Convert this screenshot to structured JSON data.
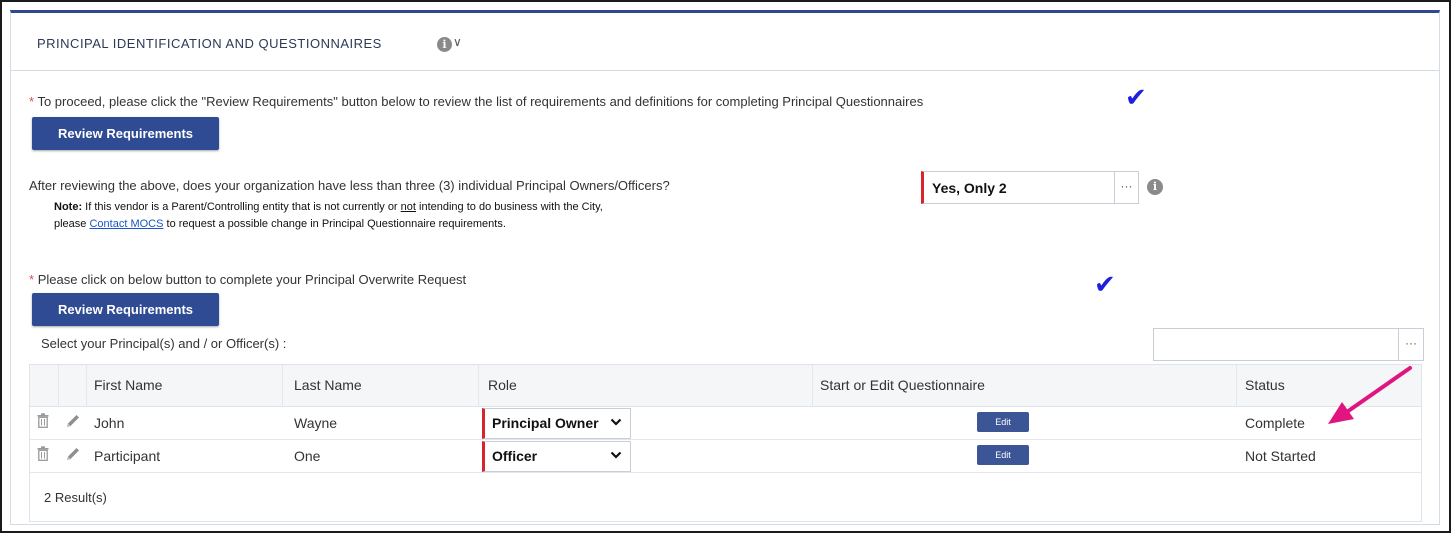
{
  "section": {
    "title": "PRINCIPAL IDENTIFICATION AND QUESTIONNAIRES",
    "info_icon": "info-circle-icon",
    "chevron_icon": "chevron-down-icon"
  },
  "requirement1": {
    "required_mark": "*",
    "text": "To proceed, please click the \"Review Requirements\" button below to review the list of requirements and definitions for completing Principal Questionnaires",
    "check_icon": "checkmark-icon",
    "button_label": "Review Requirements"
  },
  "question": {
    "text": "After reviewing the above, does your organization have less than three (3) individual Principal Owners/Officers?",
    "answer": "Yes, Only 2",
    "ellipsis": "···",
    "note_label": "Note:",
    "note_line1_pre": "If this vendor is a Parent/Controlling entity that is not currently or ",
    "note_line1_ul": "not",
    "note_line1_post": " intending to do business with the City,",
    "note_line2_pre": "please ",
    "note_link": "Contact MOCS",
    "note_line2_post": " to request a possible change in Principal Questionnaire requirements."
  },
  "requirement2": {
    "required_mark": "*",
    "text": "Please click on below button to complete your Principal Overwrite Request",
    "check_icon": "checkmark-icon",
    "button_label": "Review Requirements"
  },
  "principals": {
    "label": "Select your Principal(s) and / or Officer(s) :",
    "search_value": "",
    "search_ellipsis": "···",
    "columns": [
      "First Name",
      "Last Name",
      "Role",
      "Start or Edit Questionnaire",
      "Status"
    ],
    "rows": [
      {
        "first_name": "John",
        "last_name": "Wayne",
        "role": "Principal Owner",
        "edit_label": "Edit",
        "status": "Complete"
      },
      {
        "first_name": "Participant",
        "last_name": "One",
        "role": "Officer",
        "edit_label": "Edit",
        "status": "Not Started"
      }
    ],
    "results": "2 Result(s)"
  },
  "colors": {
    "primary_button": "#2f4b94",
    "panel_top_border": "#2e4a8e",
    "required_red": "#d9232e",
    "checkmark": "#1f1fe0",
    "annotation_arrow": "#e0157f"
  }
}
